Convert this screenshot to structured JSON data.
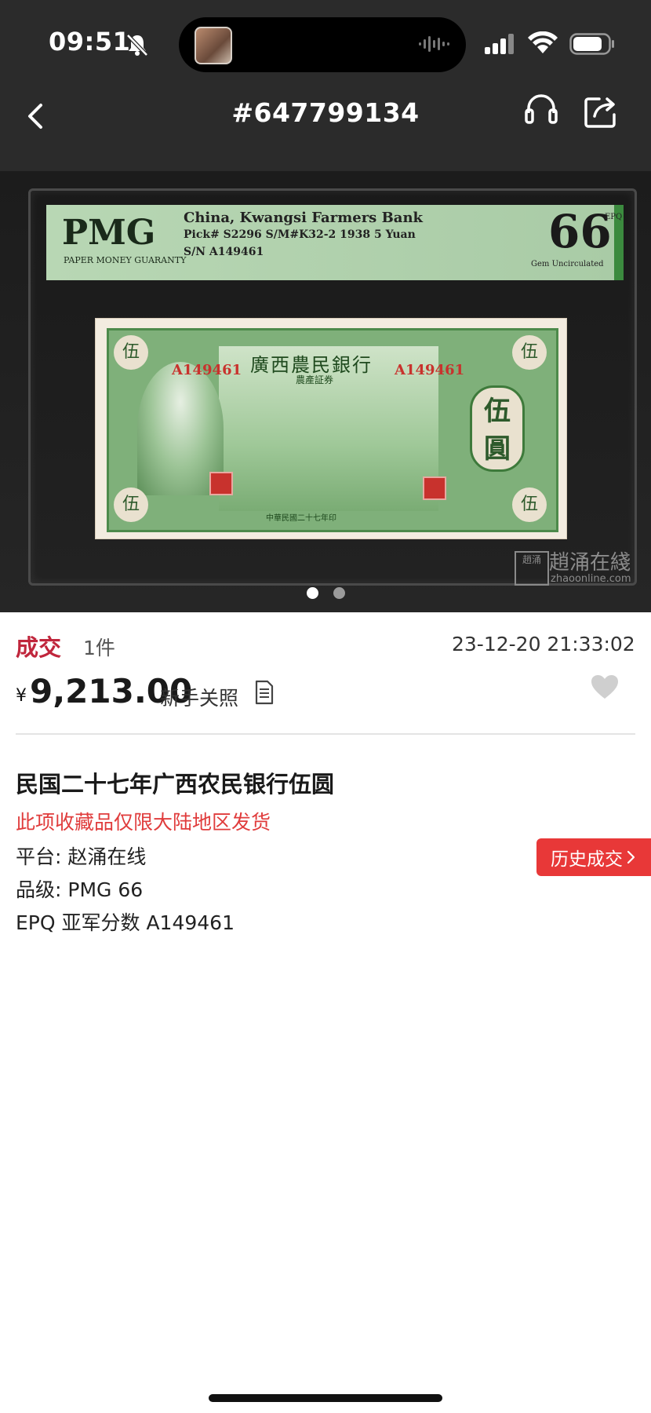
{
  "status_bar": {
    "time": "09:51",
    "icons": [
      "bell-slash-icon",
      "audio-wave-icon",
      "signal-icon",
      "wifi-icon",
      "battery-icon"
    ]
  },
  "nav": {
    "title": "#647799134",
    "back_icon": "chevron-left-icon",
    "service_icon": "headset-icon",
    "share_icon": "share-icon"
  },
  "image": {
    "pmg_brand": "PMG",
    "pmg_guarantee": "PAPER MONEY GUARANTY",
    "pmg_line1": "China, Kwangsi Farmers Bank",
    "pmg_line2": "Pick# S2296  S/M#K32-2    1938  5 Yuan",
    "pmg_line3": "S/N A149461",
    "pmg_grade": "66",
    "pmg_epq": "EPQ",
    "pmg_grade_desc": "Gem Uncirculated",
    "note_title": "廣西農民銀行",
    "note_subtitle": "農產証券",
    "note_serial": "A149461",
    "note_value": "伍圓",
    "note_corner": "伍",
    "note_bottom": "中華民國二十七年印",
    "watermark_box": "趙涌",
    "watermark_cn": "趙涌在綫",
    "watermark_en": "zhaoonline.com",
    "page_count": 2,
    "active_index": 0
  },
  "info": {
    "status": "成交",
    "quantity": "1件",
    "datetime": "23-12-20 21:33:02",
    "currency_symbol": "¥",
    "price": "9,213.00",
    "newbie_label": "新手关照",
    "title": "民国二十七年广西农民银行伍圆",
    "restriction": "此项收藏品仅限大陆地区发货",
    "platform": "平台: 赵涌在线",
    "grade": "品级: PMG 66",
    "extra": "EPQ  亚军分数 A149461",
    "history_button": "历史成交"
  },
  "colors": {
    "accent_red": "#c0263c",
    "button_red": "#e83838",
    "header_bg": "#2b2b2b"
  }
}
